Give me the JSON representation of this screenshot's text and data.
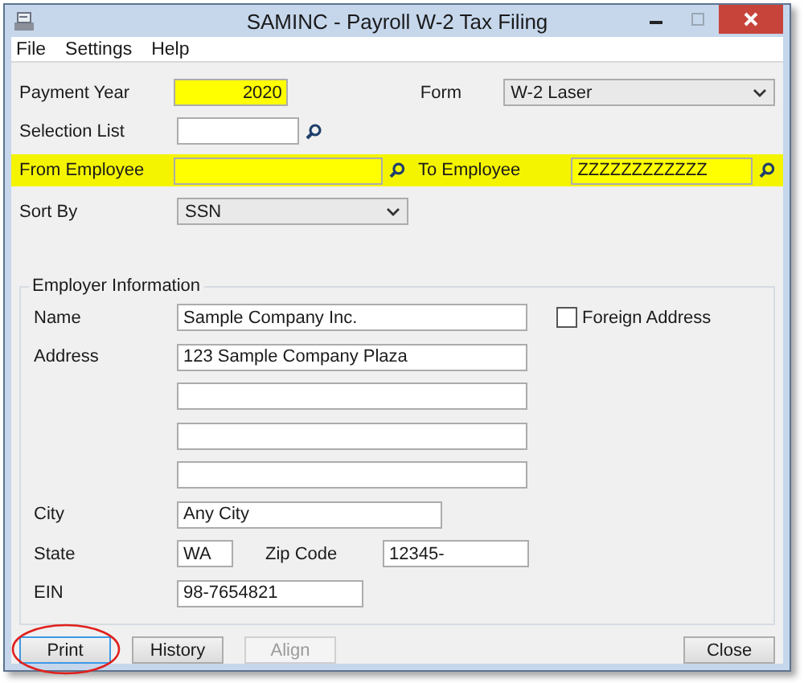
{
  "window": {
    "title": "SAMINC - Payroll W-2 Tax Filing"
  },
  "menu": [
    "File",
    "Settings",
    "Help"
  ],
  "payment_year": {
    "label": "Payment Year",
    "value": "2020",
    "required": true
  },
  "form": {
    "label": "Form",
    "value": "W-2 Laser"
  },
  "selection_list": {
    "label": "Selection List"
  },
  "employee_range": {
    "highlighted": true,
    "from": {
      "label": "From Employee",
      "required": true
    },
    "to": {
      "label": "To Employee",
      "value": "ZZZZZZZZZZZZ",
      "required": true
    }
  },
  "sort_by": {
    "label": "Sort By",
    "value": "SSN"
  },
  "employer": {
    "title": "Employer Information",
    "name": {
      "label": "Name",
      "value": "Sample Company Inc."
    },
    "foreign_address": {
      "label": "Foreign Address",
      "checked": false
    },
    "address": {
      "label": "Address",
      "value": "123 Sample Company Plaza"
    },
    "city": {
      "label": "City",
      "value": "Any City"
    },
    "state": {
      "label": "State",
      "value": "WA"
    },
    "zip": {
      "label": "Zip Code",
      "value": "12345-"
    },
    "ein": {
      "label": "EIN",
      "value": "98-7654821"
    }
  },
  "buttons": [
    {
      "label": "Print",
      "disabled": false,
      "focused": true,
      "circled": true
    },
    {
      "label": "History",
      "disabled": false,
      "focused": false,
      "circled": false
    },
    {
      "label": "Align",
      "disabled": true,
      "focused": false,
      "circled": false
    },
    {
      "label": "Close",
      "disabled": false,
      "focused": false,
      "circled": false
    }
  ]
}
